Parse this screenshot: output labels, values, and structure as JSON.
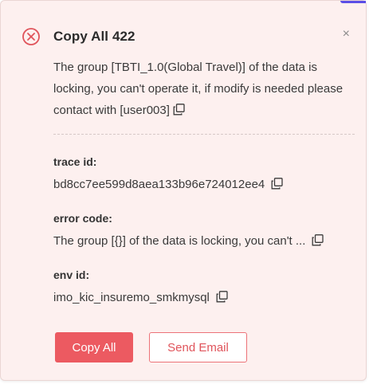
{
  "dialog": {
    "title": "Copy All 422",
    "close_label": "×",
    "message": "The group [TBTI_1.0(Global Travel)] of the data is locking, you can't operate it, if modify is needed please contact with [user003]",
    "fields": [
      {
        "label": "trace id:",
        "value": "bd8cc7ee599d8aea133b96e724012ee4"
      },
      {
        "label": "error code:",
        "value": "The group [{}] of the data is locking, you can't ..."
      },
      {
        "label": "env id:",
        "value": "imo_kic_insuremo_smkmysql"
      }
    ],
    "buttons": {
      "copy_all": "Copy All",
      "send_email": "Send Email"
    },
    "icons": {
      "status": "error-circle-x-icon",
      "copy": "copy-icon",
      "close": "close-icon"
    },
    "colors": {
      "accent": "#ec5a61",
      "background": "#fdf0ef",
      "error_icon": "#e0545b"
    }
  }
}
